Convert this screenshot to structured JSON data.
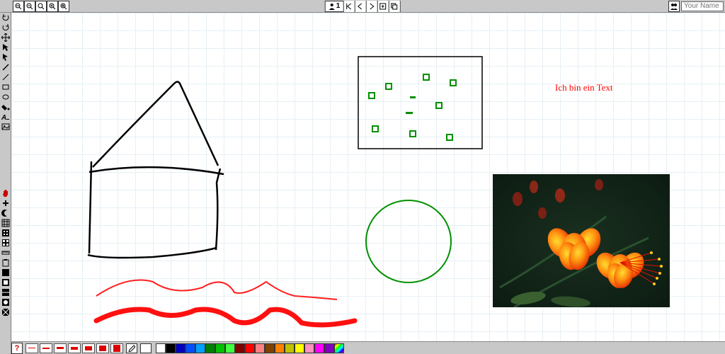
{
  "topbar": {
    "user_count": "1",
    "name_placeholder": "Your Name"
  },
  "canvas_objects": {
    "text_1": "Ich bin ein Text"
  },
  "stroke_widths": [
    1,
    2,
    3,
    4,
    6,
    8,
    10
  ],
  "palette": [
    "#ffffff",
    "#000000",
    "#0000c0",
    "#0050ff",
    "#00a0ff",
    "#008000",
    "#00c000",
    "#40ff40",
    "#800000",
    "#ff0000",
    "#ff8080",
    "#804000",
    "#ff8000",
    "#c0c000",
    "#ffff00",
    "#ff90c0",
    "#ff00ff",
    "#8000c0"
  ],
  "gradient_swatch": "rainbow",
  "left_tools_top": [
    "undo-icon",
    "redo-icon",
    "move-icon",
    "select-icon",
    "pointer-icon",
    "pen-icon",
    "line-icon",
    "rect-icon",
    "ellipse-icon",
    "bucket-icon",
    "text-icon",
    "image-icon"
  ],
  "left_tools_bottom": [
    "hand-icon",
    "add-icon",
    "moon-icon",
    "grid-icon",
    "pattern-a-icon",
    "pattern-b-icon",
    "clipboard-icon",
    "overlay-a-icon",
    "overlay-b-icon",
    "overlay-c-icon",
    "overlay-d-icon",
    "overlay-e-icon"
  ],
  "zoom_tools": [
    "zoom-out-full-icon",
    "zoom-out-icon",
    "zoom-fit-icon",
    "zoom-in-icon",
    "zoom-in-full-icon"
  ],
  "center_tools": [
    "page-first-icon",
    "page-prev-icon",
    "page-next-icon",
    "page-add-icon",
    "pages-icon"
  ]
}
